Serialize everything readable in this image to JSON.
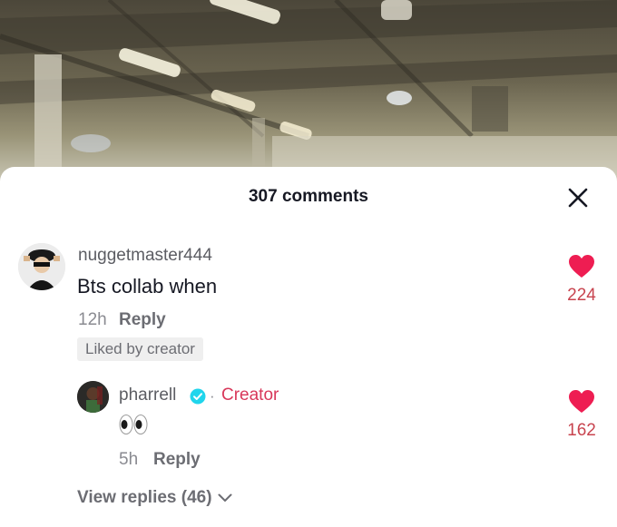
{
  "sheet": {
    "title": "307 comments"
  },
  "comments": [
    {
      "username": "nuggetmaster444",
      "text": "Bts collab when",
      "time": "12h",
      "reply_label": "Reply",
      "badge": "Liked by creator",
      "likes": "224"
    }
  ],
  "reply": {
    "username": "pharrell",
    "separator": "·",
    "creator_label": "Creator",
    "text_emoji": "eyes-emoji",
    "time": "5h",
    "reply_label": "Reply",
    "likes": "162"
  },
  "view_replies": "View replies (46)",
  "colors": {
    "like_red": "#ee1d52",
    "creator_red": "#d8385a",
    "verified_blue": "#20d5ec"
  }
}
